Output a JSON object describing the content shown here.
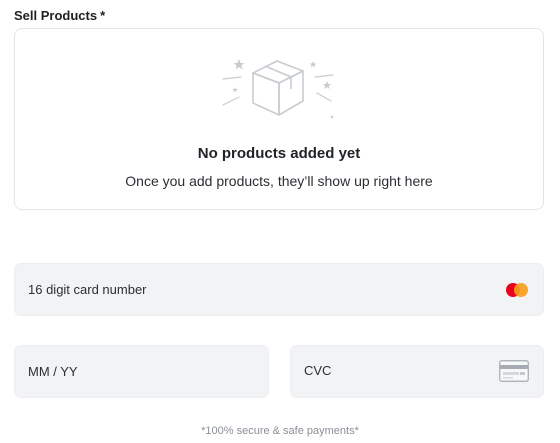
{
  "section": {
    "label": "Sell Products",
    "required_mark": "*"
  },
  "empty_state": {
    "title": "No products added yet",
    "subtitle": "Once you add products, they’ll show up right here",
    "icon": "empty-box-illustration"
  },
  "payment": {
    "card_number": {
      "placeholder": "16 digit card number",
      "value": "",
      "icon": "mastercard-icon"
    },
    "expiry": {
      "placeholder": "MM / YY",
      "value": ""
    },
    "cvc": {
      "placeholder": "CVC",
      "value": "",
      "icon": "card-back-icon"
    }
  },
  "footnote": "*100% secure & safe payments*",
  "colors": {
    "mastercard_red": "#eb001b",
    "mastercard_orange": "#f79e1b",
    "field_bg": "#f2f3f5"
  }
}
